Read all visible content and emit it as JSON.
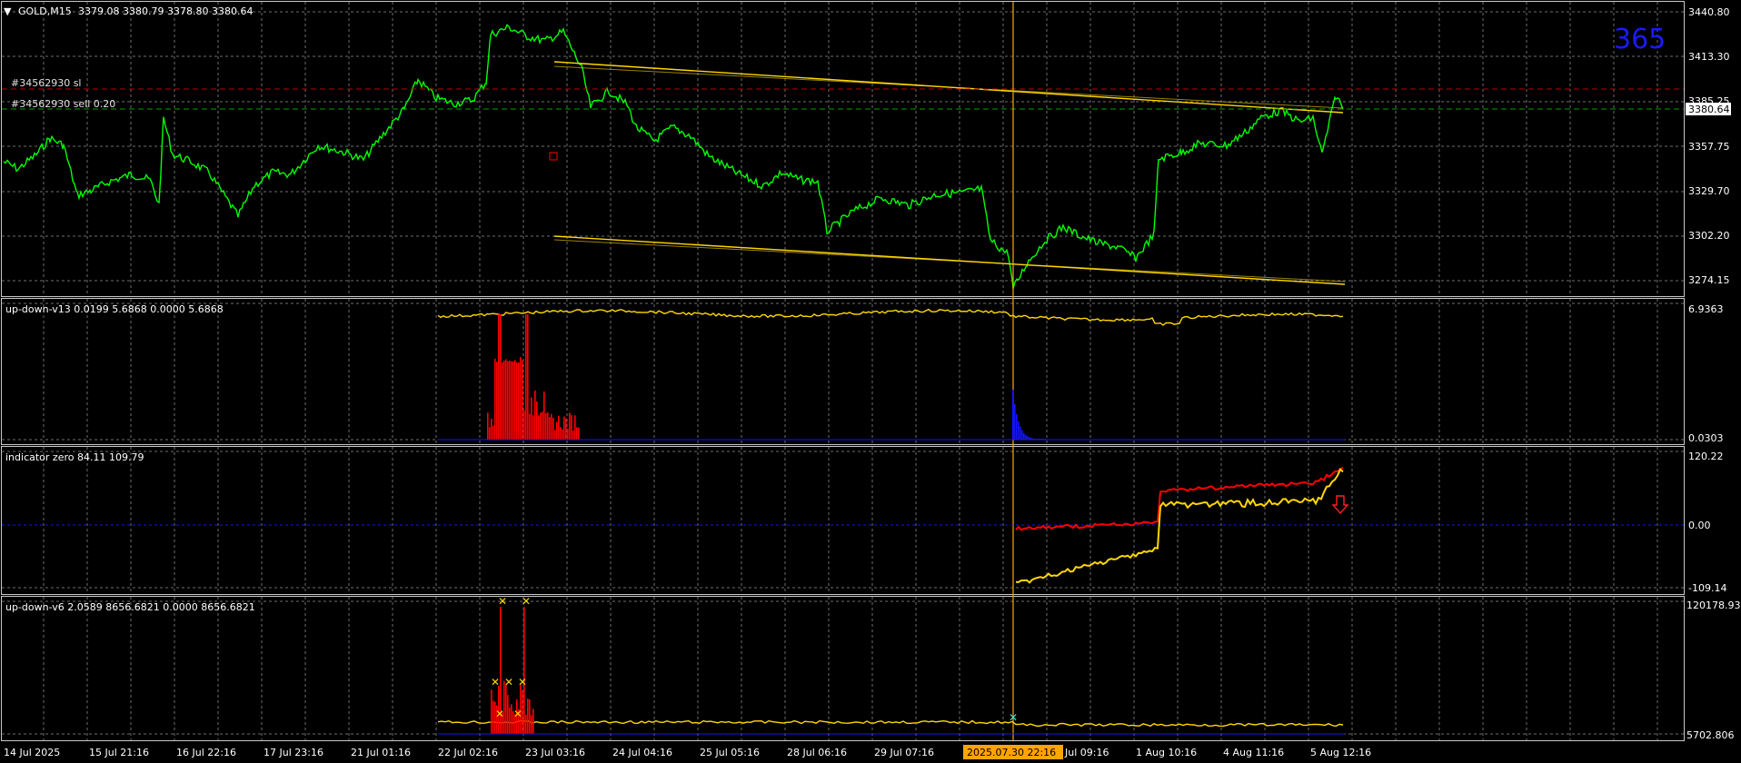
{
  "chart_header": {
    "symbol_label": "GOLD,M15",
    "ohlc": "3379.08 3380.79 3378.80 3380.64"
  },
  "watermark": "365",
  "colors": {
    "price_line": "#00ff00",
    "channel": "#ffd700",
    "indicator_red": "#ff0000",
    "indicator_yellow": "#ffd700",
    "indicator_blue": "#1515ff",
    "grid": "#6e6e6e",
    "panel_border": "#c8c8c8",
    "vline": "#ffa500",
    "sl_line": "#c00000",
    "entry_line": "#00a000"
  },
  "order_labels": {
    "sl": "#34562930 sl",
    "entry": "#34562930 sell 0.20"
  },
  "main_panel": {
    "price_axis": [
      "3440.80",
      "3413.30",
      "3385.25",
      "3357.75",
      "3329.70",
      "3302.20",
      "3274.15"
    ],
    "current_price": "3380.64"
  },
  "indicators": [
    {
      "label": "up-down-v13 0.0199 5.6868 0.0000 5.6868",
      "axis_top": "6.9363",
      "axis_bottom": "0.0303"
    },
    {
      "label": "indicator zero 84.11 109.79",
      "axis_top": "120.22",
      "axis_mid": "0.00",
      "axis_bottom": "-109.14"
    },
    {
      "label": "up-down-v6 2.0589 8656.6821 0.0000 8656.6821",
      "axis_top": "120178.93",
      "axis_bottom": "5702.806"
    }
  ],
  "time_axis": [
    "14 Jul 2025",
    "15 Jul 21:16",
    "16 Jul 22:16",
    "17 Jul 23:16",
    "21 Jul 01:16",
    "22 Jul 02:16",
    "23 Jul 03:16",
    "24 Jul 04:16",
    "25 Jul 05:16",
    "28 Jul 06:16",
    "29 Jul 07:16",
    "Jul 09:16",
    "1 Aug 10:16",
    "4 Aug 11:16",
    "5 Aug 12:16"
  ],
  "cursor_time": "2025.07.30 22:16"
}
